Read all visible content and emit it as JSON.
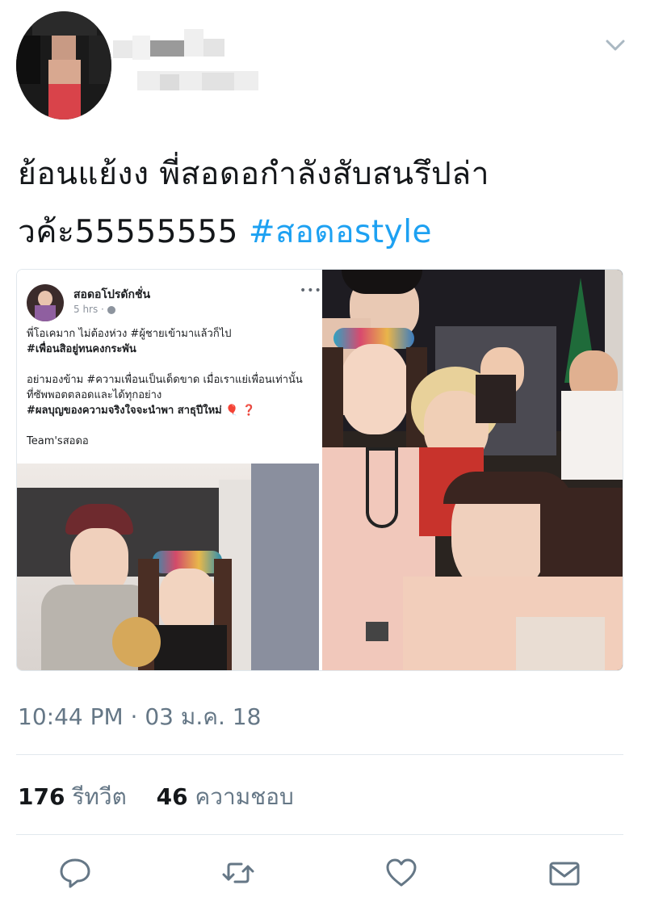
{
  "tweet": {
    "text_main": "ย้อนแย้งง พี่สอดอกำลังสับสนรึปล่าวค้ะ55555555",
    "hashtag": "#สอดอstyle",
    "timestamp": "10:44 PM · 03 ม.ค. 18",
    "retweets_count": "176",
    "retweets_label": "รีทวีต",
    "likes_count": "46",
    "likes_label": "ความชอบ"
  },
  "embedded_post": {
    "author": "สอดอโปรดักชั่น",
    "time": "5 hrs · ",
    "more": "•••",
    "lines": [
      "พี่โอเคมาก ไม่ต้องห่วง  #ผู้ชายเข้ามาแล้วก็ไป",
      "#เพื่อนสิอยู่ทนคงกระพัน",
      "",
      "อย่ามองข้าม #ความเพื่อนเป็นเด็ดขาด เมื่อเราแย่เพื่อนเท่านั้น",
      "ที่ซัพพอตตลอดและได้ทุกอย่าง",
      "#ผลบุญของความจริงใจจะนำพา สาธุปีใหม่ 🎈 ❓",
      "",
      "Team'sสอดอ"
    ]
  },
  "icons": {
    "caret": "chevron-down-icon",
    "reply": "reply-icon",
    "retweet": "retweet-icon",
    "like": "heart-icon",
    "dm": "envelope-icon"
  },
  "colors": {
    "hashtag": "#1da1f2",
    "secondary_text": "#657786",
    "icon": "#657786"
  }
}
